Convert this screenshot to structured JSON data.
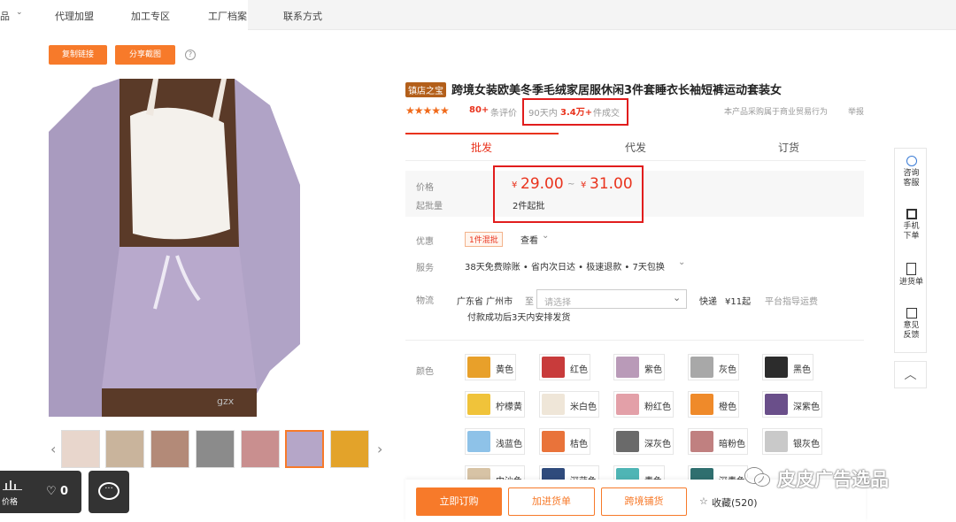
{
  "nav": {
    "items": [
      "品",
      "代理加盟",
      "加工专区",
      "工厂档案",
      "联系方式"
    ]
  },
  "actions": {
    "copy_link": "复制链接",
    "share_screenshot": "分享截图",
    "help": "?"
  },
  "product": {
    "badge": "镇店之宝",
    "title": "跨境女装欧美冬季毛绒家居服休闲3件套睡衣长袖短裤运动套装女",
    "rating_count": "80+",
    "rating_label": "条评价",
    "sales_prefix": "90天内",
    "sales_value": "3.4万+",
    "sales_suffix": "件成交",
    "purchase_note": "本产品采购属于商业贸易行为",
    "report": "举报"
  },
  "tabs": [
    "批发",
    "代发",
    "订货"
  ],
  "price": {
    "label_price": "价格",
    "label_moq": "起批量",
    "currency": "¥",
    "min": "29.00",
    "tilde": "~",
    "max": "31.00",
    "moq": "2件起批"
  },
  "promo": {
    "label": "优惠",
    "tag": "1件混批",
    "more": "查看"
  },
  "service": {
    "label": "服务",
    "text": "38天免费赊账 • 省内次日达 • 极速退款 • 7天包换"
  },
  "logistics": {
    "label": "物流",
    "from": "广东省 广州市",
    "to_label": "至",
    "placeholder": "请选择",
    "express": "快递",
    "fee": "¥11起",
    "guide": "平台指导运费",
    "note": "付款成功后3天内安排发货"
  },
  "colors": {
    "label": "颜色",
    "items": [
      {
        "name": "黄色",
        "hex": "#e8a02a"
      },
      {
        "name": "红色",
        "hex": "#c83b3b"
      },
      {
        "name": "紫色",
        "hex": "#b99ab8"
      },
      {
        "name": "灰色",
        "hex": "#a8a8a8"
      },
      {
        "name": "黑色",
        "hex": "#2c2c2c"
      },
      {
        "name": "柠檬黄",
        "hex": "#f0c33a"
      },
      {
        "name": "米白色",
        "hex": "#efe6d8"
      },
      {
        "name": "粉红色",
        "hex": "#e3a0a8"
      },
      {
        "name": "橙色",
        "hex": "#ef8a2a"
      },
      {
        "name": "深紫色",
        "hex": "#6a4f8a"
      },
      {
        "name": "浅蓝色",
        "hex": "#8ec2e8"
      },
      {
        "name": "桔色",
        "hex": "#e9733a"
      },
      {
        "name": "深灰色",
        "hex": "#6a6a6a"
      },
      {
        "name": "暗粉色",
        "hex": "#c08080"
      },
      {
        "name": "银灰色",
        "hex": "#c9c9c9"
      },
      {
        "name": "中沙色",
        "hex": "#d7c3a5"
      },
      {
        "name": "深蓝色",
        "hex": "#2f4b7c"
      },
      {
        "name": "青色",
        "hex": "#4fb5b5"
      },
      {
        "name": "深青色",
        "hex": "#2f6f6f"
      }
    ]
  },
  "sidebar": {
    "consult": "咨询客服",
    "mobile": "手机下单",
    "list": "进货单",
    "feedback": "意见反馈"
  },
  "bottom": {
    "buy": "立即订购",
    "add": "加进货单",
    "cross": "跨境铺货",
    "fav": "收藏(520)"
  },
  "floating": {
    "price_label": "价格",
    "like_count": "0"
  },
  "watermark": {
    "text": "皮皮广告选品",
    "img": "gzx"
  },
  "theme": {
    "accent": "#f77a2a",
    "red": "#e11d1d",
    "price": "#e9331d",
    "shop_badge": "#b35f1a"
  }
}
